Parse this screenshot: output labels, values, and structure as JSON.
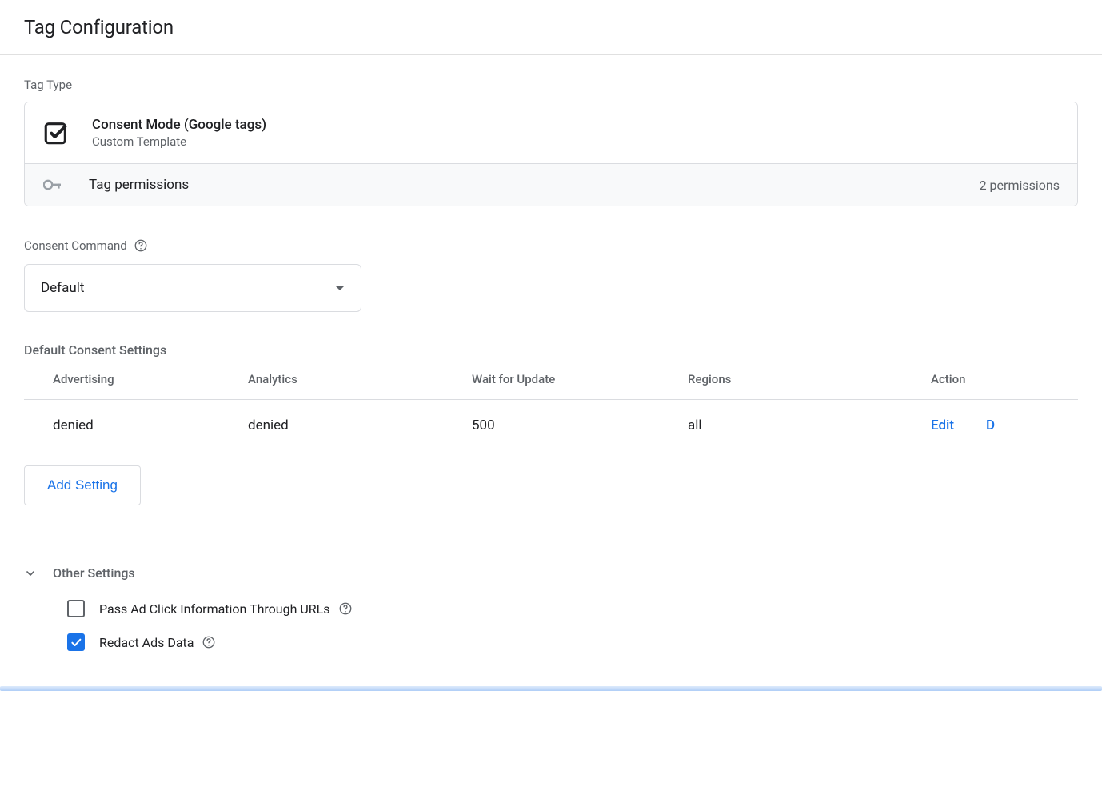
{
  "header": {
    "title": "Tag Configuration"
  },
  "tagType": {
    "sectionLabel": "Tag Type",
    "title": "Consent Mode (Google tags)",
    "subtitle": "Custom Template",
    "permissionsLabel": "Tag permissions",
    "permissionsCount": "2 permissions"
  },
  "consentCommand": {
    "label": "Consent Command",
    "selected": "Default"
  },
  "defaultSettings": {
    "title": "Default Consent Settings",
    "columns": {
      "advertising": "Advertising",
      "analytics": "Analytics",
      "wait": "Wait for Update",
      "regions": "Regions",
      "action": "Action"
    },
    "rows": [
      {
        "advertising": "denied",
        "analytics": "denied",
        "wait": "500",
        "regions": "all",
        "editLabel": "Edit",
        "deleteLabel": "D"
      }
    ],
    "addSettingLabel": "Add Setting"
  },
  "otherSettings": {
    "title": "Other Settings",
    "items": [
      {
        "label": "Pass Ad Click Information Through URLs",
        "checked": false
      },
      {
        "label": "Redact Ads Data",
        "checked": true
      }
    ]
  }
}
